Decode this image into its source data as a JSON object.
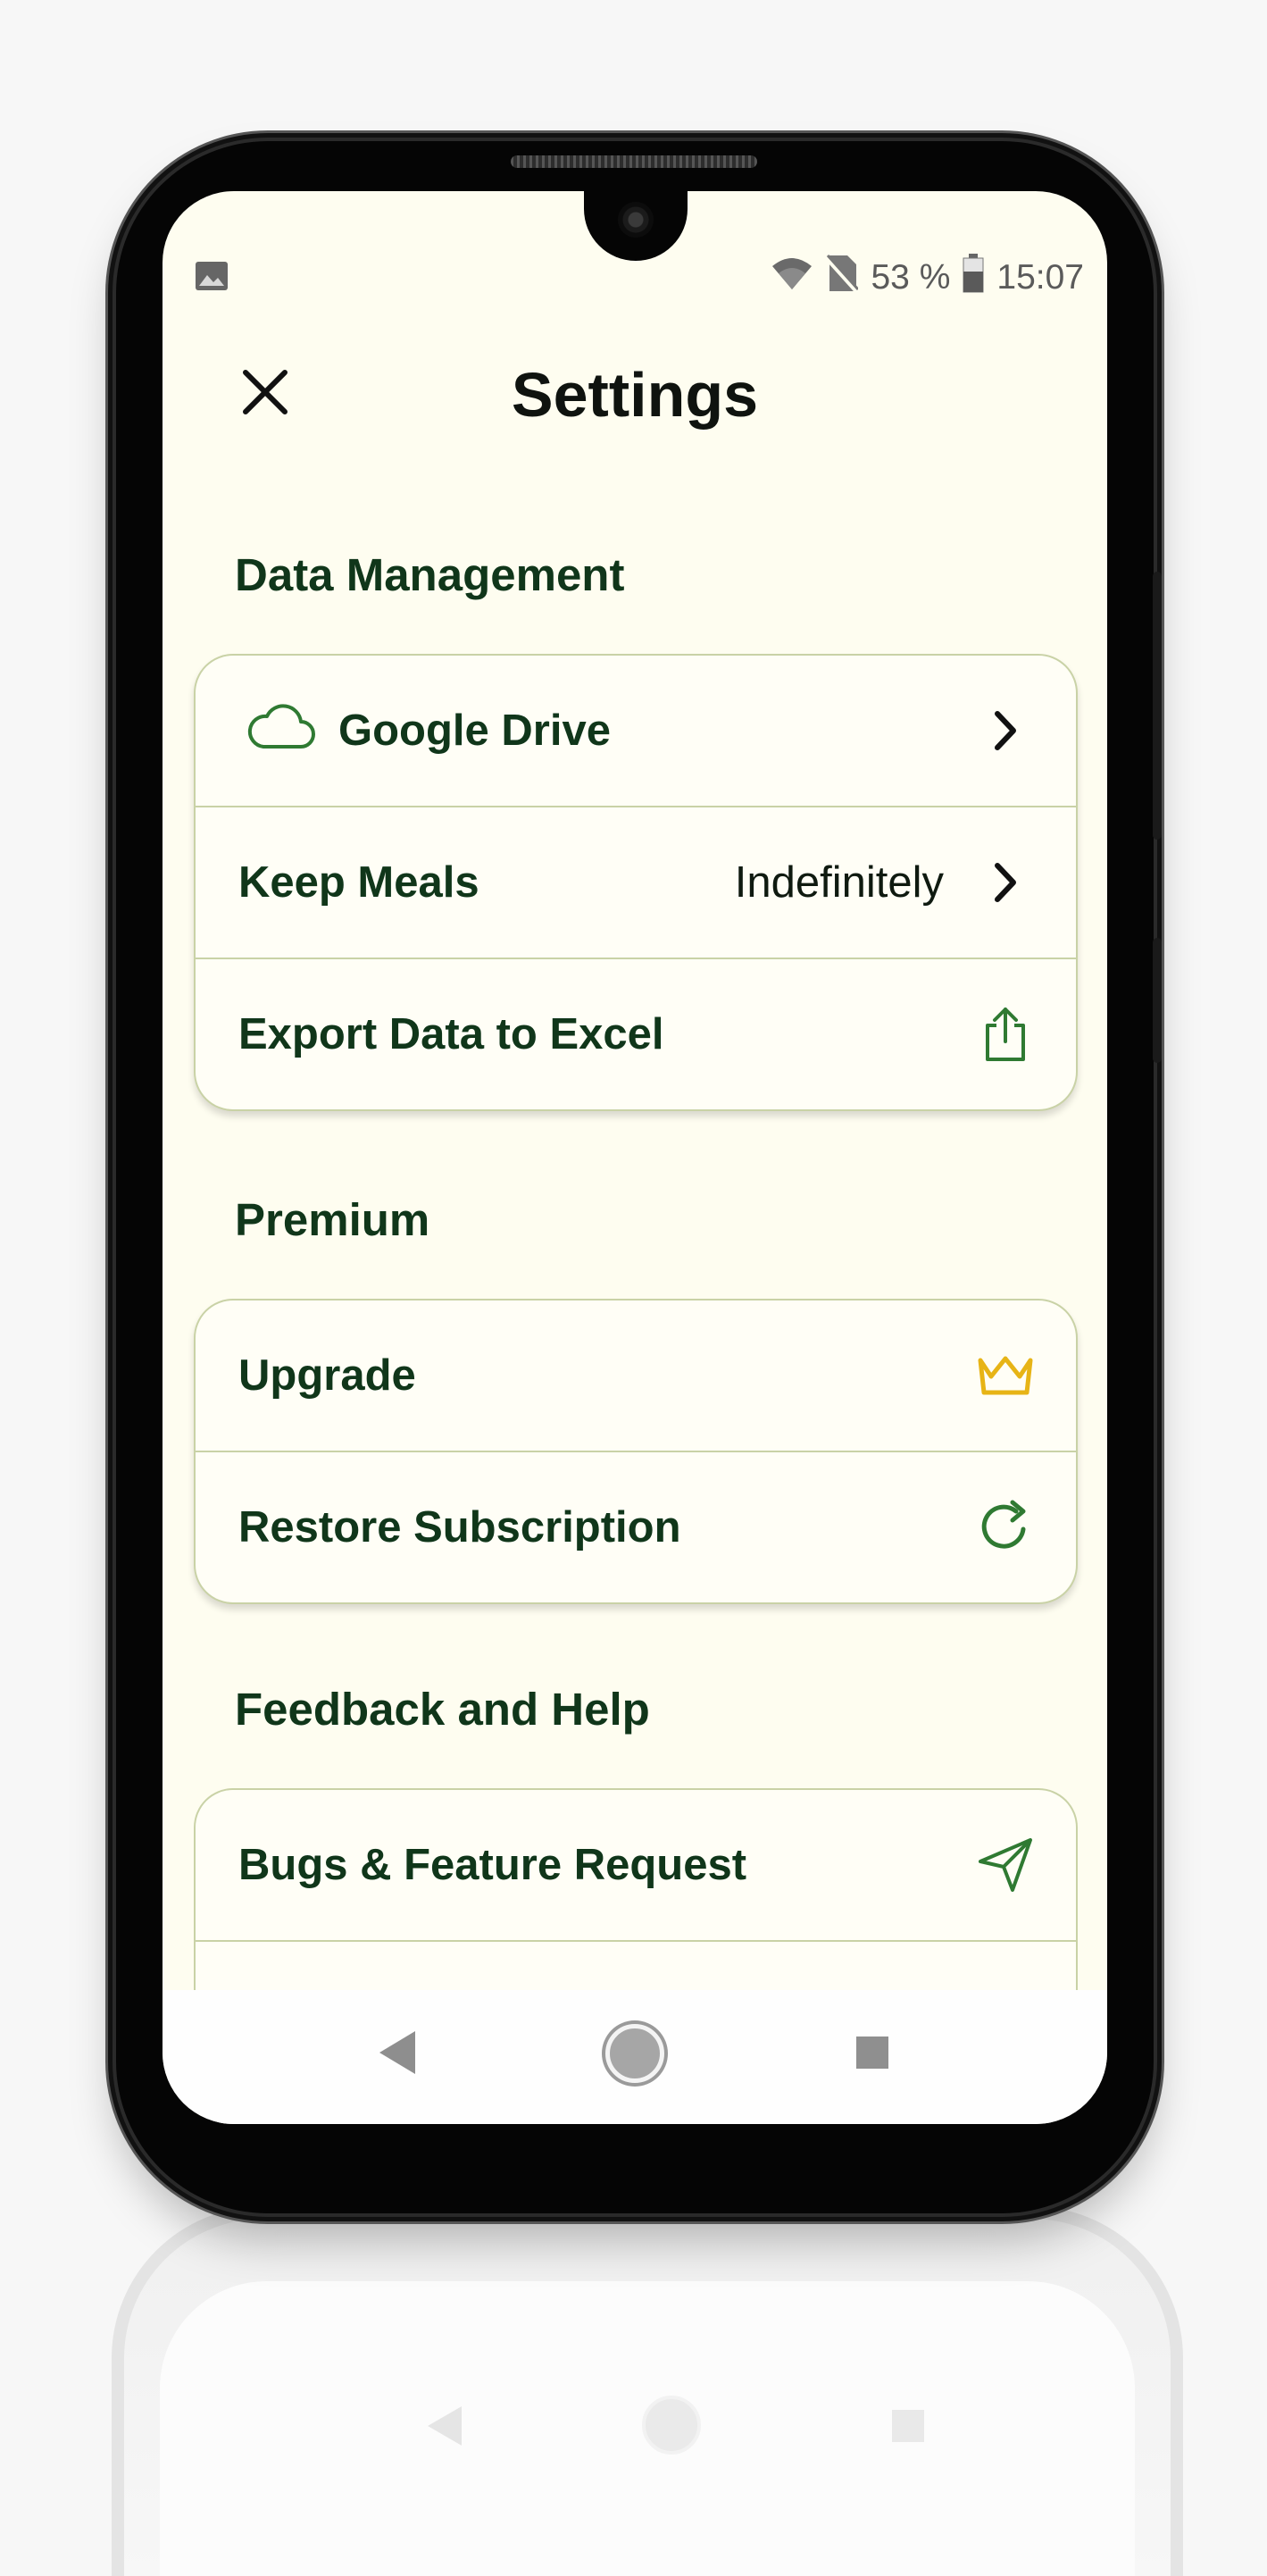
{
  "status_bar": {
    "battery_percent": "53 %",
    "time": "15:07",
    "icons": [
      "image-icon",
      "wifi-icon",
      "no-sim-icon",
      "battery-icon"
    ]
  },
  "header": {
    "title": "Settings",
    "close_icon": "close-icon"
  },
  "sections": {
    "data_management": {
      "title": "Data Management",
      "google_drive": {
        "label": "Google Drive",
        "icon": "cloud-icon"
      },
      "keep_meals": {
        "label": "Keep Meals",
        "value": "Indefinitely"
      },
      "export_excel": {
        "label": "Export Data to Excel",
        "icon": "share-icon"
      }
    },
    "premium": {
      "title": "Premium",
      "upgrade": {
        "label": "Upgrade",
        "icon": "crown-icon"
      },
      "restore": {
        "label": "Restore Subscription",
        "icon": "refresh-icon"
      }
    },
    "feedback": {
      "title": "Feedback and Help",
      "bugs": {
        "label": "Bugs & Feature Request",
        "icon": "send-icon"
      }
    }
  },
  "nav_bar": {
    "icons": [
      "back-icon",
      "home-icon",
      "recent-apps-icon"
    ]
  },
  "colors": {
    "background": "#fefdf0",
    "text_green": "#10361a",
    "icon_green": "#2f7a32",
    "crown_yellow": "#e7b416",
    "card_border": "#c9d2a6"
  }
}
